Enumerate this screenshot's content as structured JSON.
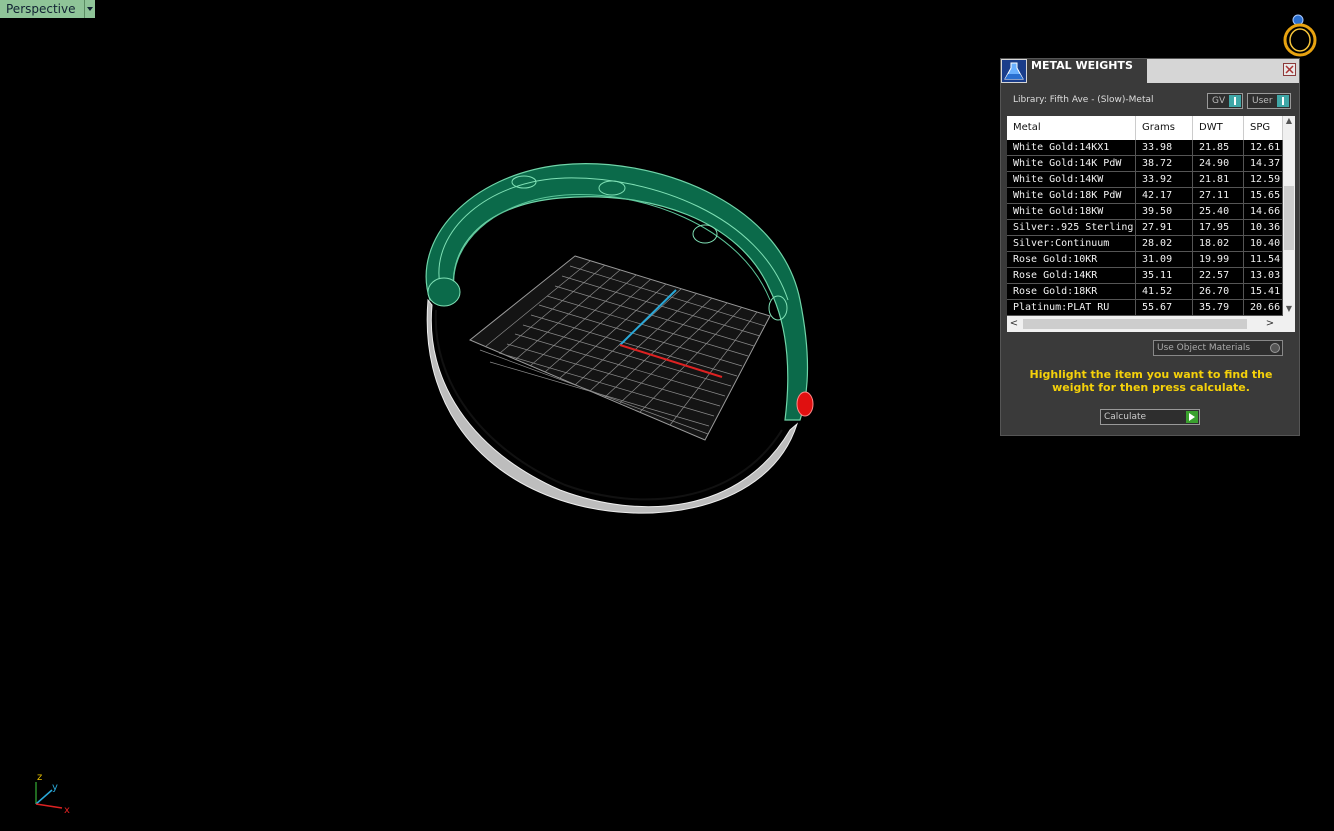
{
  "viewport": {
    "label": "Perspective",
    "grid_color": "#8a8a8a",
    "ring_color": "#0b6a4a",
    "axis_labels": {
      "z": "z",
      "y": "y",
      "x": "x"
    }
  },
  "panel": {
    "title": "METAL WEIGHTS",
    "library": "Library: Fifth Ave - (Slow)-Metal",
    "gv_label": "GV",
    "user_label": "User",
    "columns": [
      "Metal",
      "Grams",
      "DWT",
      "SPG"
    ],
    "rows": [
      {
        "metal": "White Gold:14KX1",
        "grams": "33.98",
        "dwt": "21.85",
        "spg": "12.61"
      },
      {
        "metal": "White Gold:14K PdW",
        "grams": "38.72",
        "dwt": "24.90",
        "spg": "14.37"
      },
      {
        "metal": "White Gold:14KW",
        "grams": "33.92",
        "dwt": "21.81",
        "spg": "12.59"
      },
      {
        "metal": "White Gold:18K PdW",
        "grams": "42.17",
        "dwt": "27.11",
        "spg": "15.65"
      },
      {
        "metal": "White Gold:18KW",
        "grams": "39.50",
        "dwt": "25.40",
        "spg": "14.66"
      },
      {
        "metal": "Silver:.925 Sterling",
        "grams": "27.91",
        "dwt": "17.95",
        "spg": "10.36"
      },
      {
        "metal": "Silver:Continuum",
        "grams": "28.02",
        "dwt": "18.02",
        "spg": "10.40"
      },
      {
        "metal": "Rose Gold:10KR",
        "grams": "31.09",
        "dwt": "19.99",
        "spg": "11.54"
      },
      {
        "metal": "Rose Gold:14KR",
        "grams": "35.11",
        "dwt": "22.57",
        "spg": "13.03"
      },
      {
        "metal": "Rose Gold:18KR",
        "grams": "41.52",
        "dwt": "26.70",
        "spg": "15.41"
      },
      {
        "metal": "Platinum:PLAT RU",
        "grams": "55.67",
        "dwt": "35.79",
        "spg": "20.66"
      }
    ],
    "use_object_materials": "Use Object Materials",
    "hint": "Highlight the item you want to find the weight for then press calculate.",
    "calculate_label": "Calculate",
    "hint_color": "#f5d10a"
  }
}
